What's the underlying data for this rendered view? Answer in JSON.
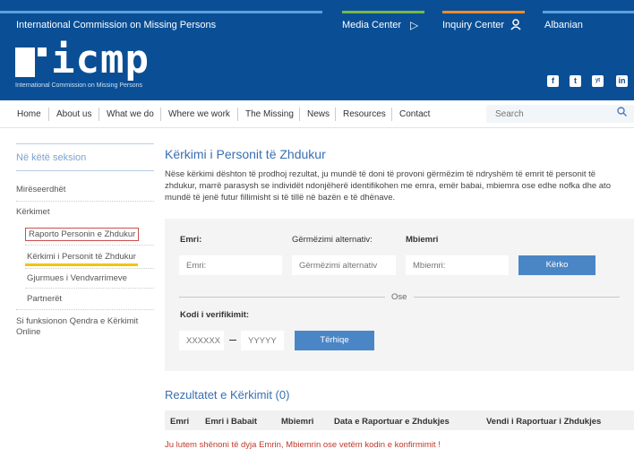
{
  "header": {
    "org_name": "International Commission on Missing Persons",
    "media_center": "Media Center",
    "inquiry_center": "Inquiry Center",
    "language": "Albanian",
    "logo_text": "icmp",
    "logo_sub": "International Commission on Missing Persons",
    "social": [
      "f",
      "t",
      "yt",
      "in"
    ],
    "accent_colors": {
      "green": "#7ab648",
      "blue_light": "#5aa0dc",
      "orange": "#f08a24",
      "yellow": "#f5c400",
      "red": "#c9504f"
    }
  },
  "nav": {
    "items": [
      "Home",
      "About us",
      "What we do",
      "Where we work",
      "The Missing",
      "News",
      "Resources",
      "Contact"
    ],
    "search_placeholder": "Search"
  },
  "sidebar": {
    "heading": "Në këtë seksion",
    "items": [
      "Mirëseerdhët",
      "Kërkimet",
      "Raporto Personin e Zhdukur",
      "Kërkimi i Personit të Zhdukur",
      "Gjurmues i Vendvarrimeve",
      "Partnerët",
      "Si funksionon Qendra e Kërkimit Online"
    ]
  },
  "main": {
    "title": "Kërkimi i Personit të Zhdukur",
    "description": "Nëse kërkimi dështon të prodhoj rezultat, ju mundë të doni të provoni gërmëzim të ndryshëm të emrit të personit të zhdukur, marrë parasysh se individët ndonjëherë identifikohen me emra, emër babai, mbiemra ose edhe nofka dhe ato mundë të jenë futur fillimisht si të tillë në bazën e të dhënave.",
    "form": {
      "first_name_label": "Emri:",
      "alt_label": "Gërmëzimi alternativ:",
      "last_name_label": "Mbiemri",
      "first_name_placeholder": "Emri:",
      "alt_placeholder": "Gërmëzimi alternativ",
      "last_name_placeholder": "Mbiemri:",
      "search_button": "Kërko",
      "or_text": "Ose",
      "code_label": "Kodi i verifikimit:",
      "code1_placeholder": "XXXXXX",
      "code2_placeholder": "YYYYY",
      "retrieve_button": "Tërhiqe"
    },
    "results_title": "Rezultatet e Kërkimit (0)",
    "columns": [
      "Emri",
      "Emri i Babait",
      "Mbiemri",
      "Data e Raportuar e Zhdukjes",
      "Vendi i Raportuar i Zhdukjes"
    ],
    "error": "Ju lutem shënoni të dyja Emrin, Mbiemrin ose vetëm kodin e konfirmimit !"
  }
}
